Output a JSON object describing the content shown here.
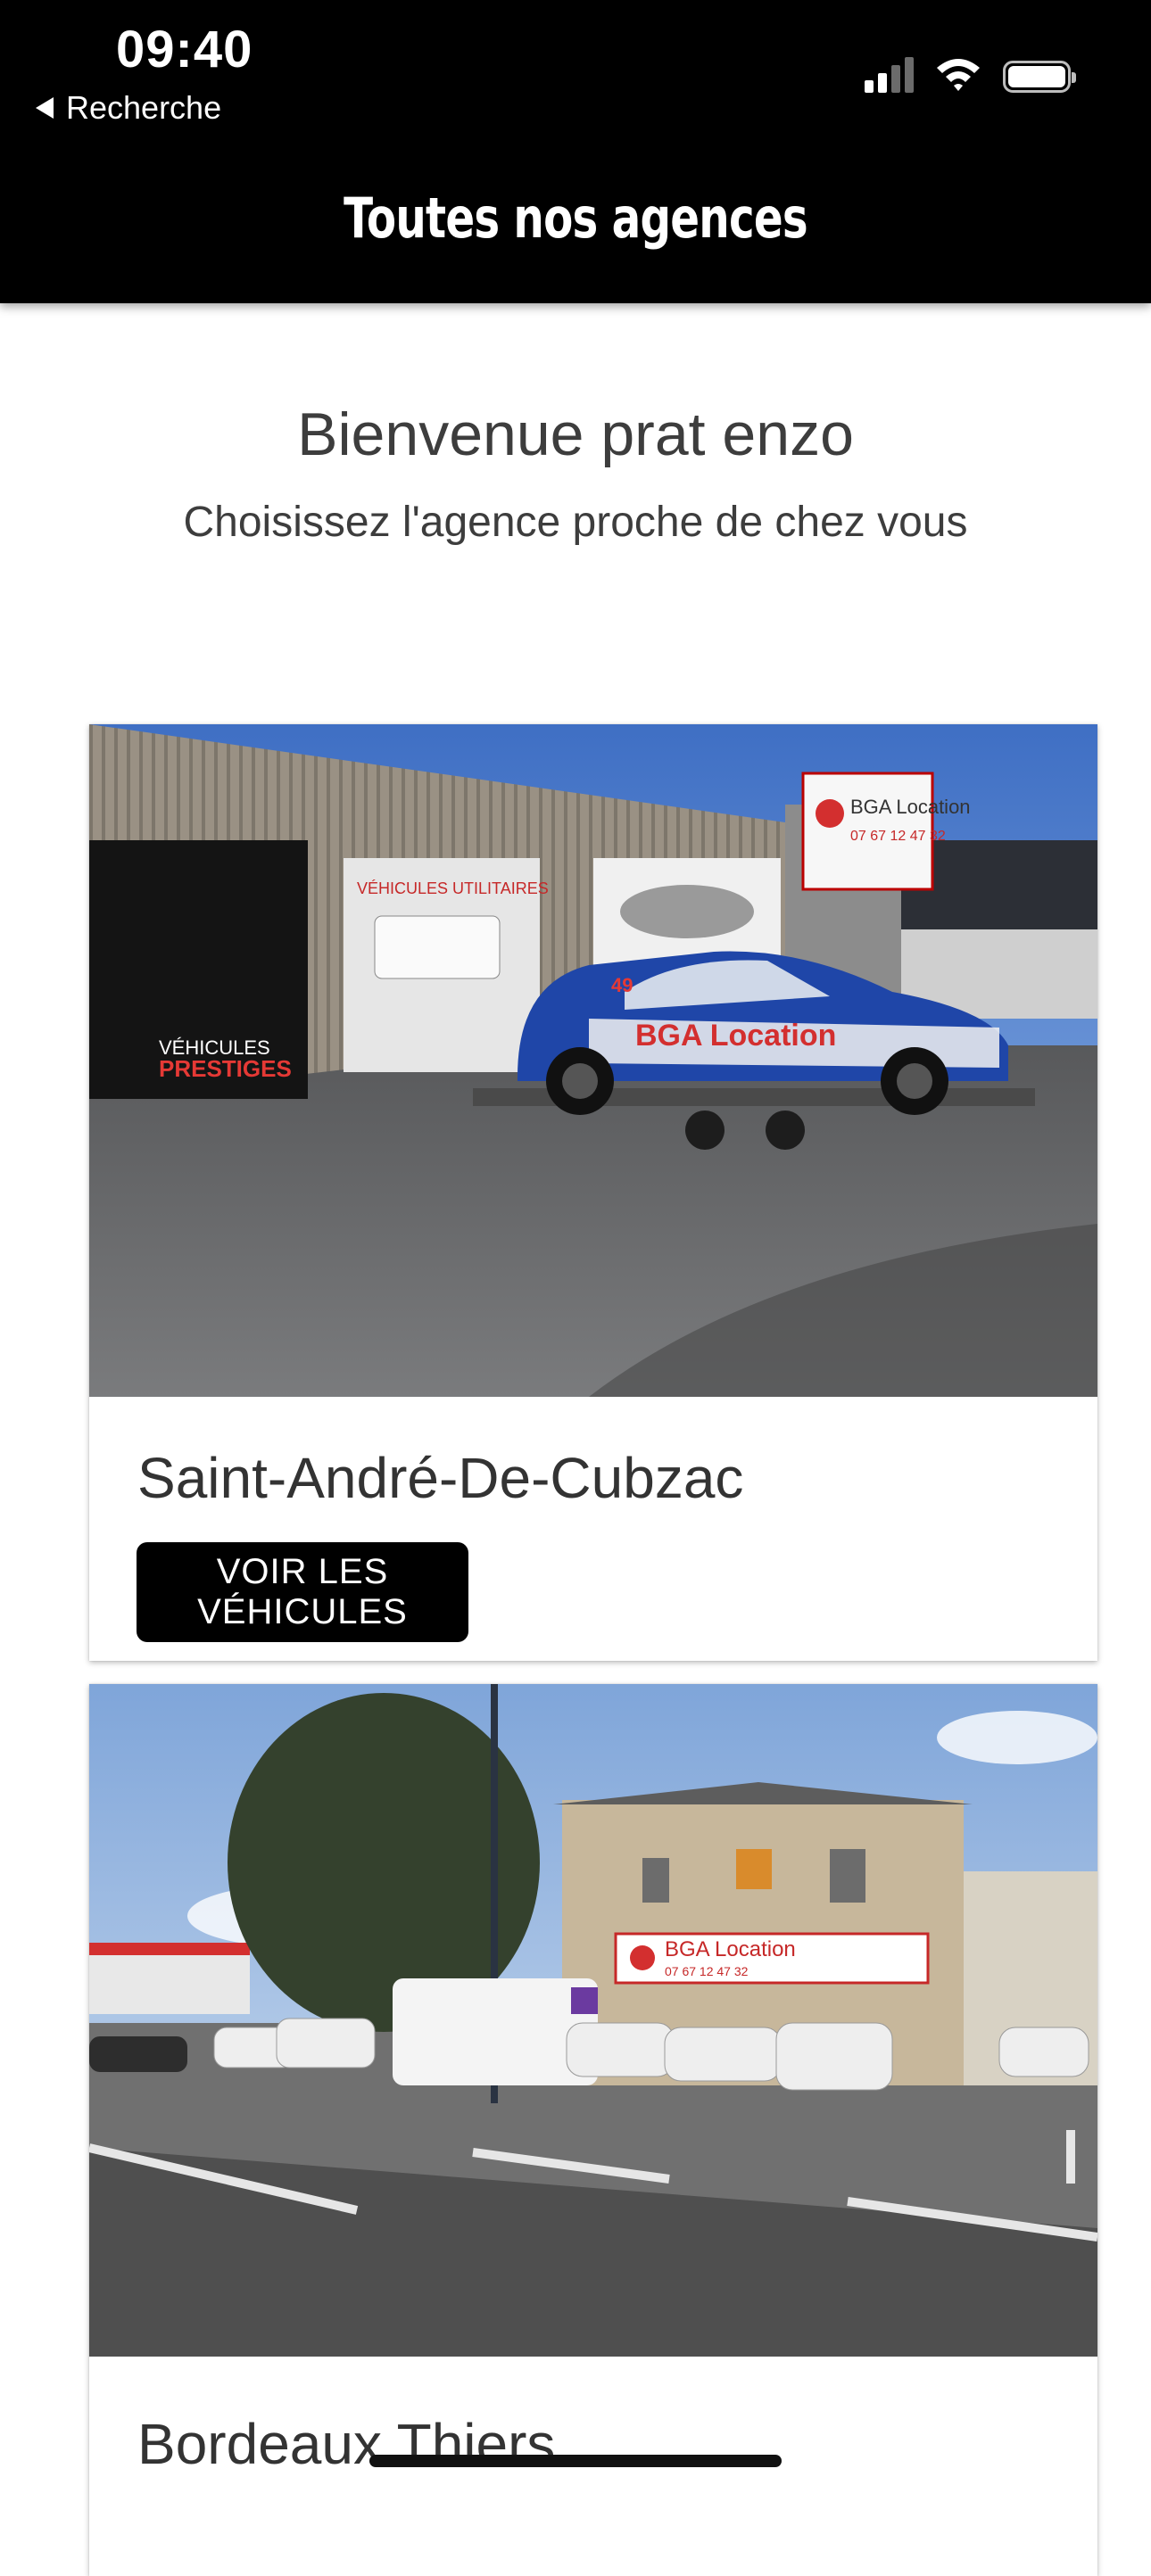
{
  "status_bar": {
    "time": "09:40",
    "back_label": "Recherche"
  },
  "header": {
    "title": "Toutes nos agences"
  },
  "welcome": {
    "greeting": "Bienvenue prat enzo",
    "subtitle": "Choisissez l'agence proche de chez vous"
  },
  "agencies": [
    {
      "name": "Saint-André-De-Cubzac",
      "button_label": "VOIR LES VÉHICULES",
      "sign_brand": "BGA Location",
      "sign_phone": "07 67 12 47 32",
      "wall_text_1": "VÉHICULES",
      "wall_text_2": "PRESTIGES",
      "wall_text_3": "VÉHICULES UTILITAIRES",
      "car_number": "49",
      "car_brand": "BGA Location"
    },
    {
      "name": "Bordeaux Thiers",
      "sign_brand": "BGA Location",
      "sign_phone": "07 67 12 47 32"
    }
  ],
  "colors": {
    "header_bg": "#000000",
    "button_bg": "#000000",
    "text_dark": "#3d3d3d"
  }
}
